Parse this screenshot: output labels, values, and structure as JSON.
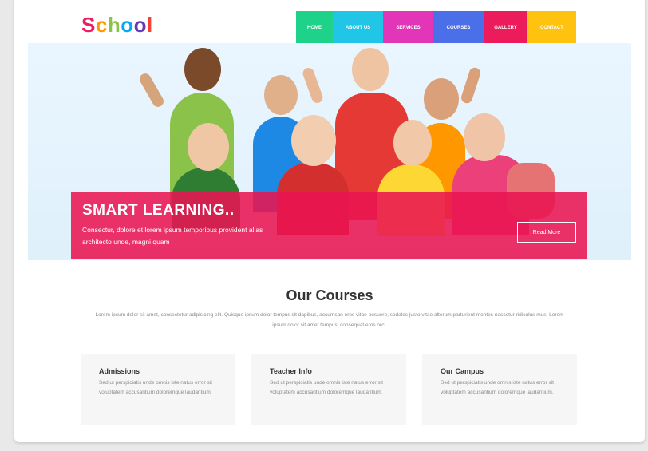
{
  "logo": {
    "letters": [
      "S",
      "c",
      "h",
      "o",
      "o",
      "l"
    ]
  },
  "nav": {
    "items": [
      {
        "label": "HOME",
        "color": "#1fd28a",
        "width": 46
      },
      {
        "label": "ABOUT US",
        "color": "#21c6e6",
        "width": 63
      },
      {
        "label": "SERVICES",
        "color": "#e335b8",
        "width": 63
      },
      {
        "label": "COURSES",
        "color": "#4b6fe8",
        "width": 63
      },
      {
        "label": "GALLERY",
        "color": "#ec1c5c",
        "width": 55
      },
      {
        "label": "CONTACT",
        "color": "#ffc20e",
        "width": 61
      }
    ]
  },
  "hero": {
    "title": "SMART LEARNING..",
    "text": "Consectur, dolore et lorem ipsum temporibus provident alias architecto unde, magni quam",
    "button_label": "Read More"
  },
  "courses": {
    "heading": "Our Courses",
    "description": "Lorem ipsum dolor sit amet, consectetur adipisicing elit. Quisque ipsum dolor tempus sit dapibus, accumsan eros vitae posuere, sodales justo vitae alterum parturient montes nascetur ridiculus mus. Lorem ipsum dolor sit amet tempus, consequat eros orci.",
    "items": [
      {
        "title": "Admissions",
        "text": "Sed ut perspiciatis unde omnis iste natus error sit voluptatem accusantium doloremque laudantium."
      },
      {
        "title": "Teacher Info",
        "text": "Sed ut perspiciatis unde omnis iste natus error sit voluptatem accusantium doloremque laudantium."
      },
      {
        "title": "Our Campus",
        "text": "Sed ut perspiciatis unde omnis iste natus error sit voluptatem accusantium doloremque laudantium."
      }
    ]
  },
  "colors": {
    "accent": "#e91552",
    "hero_bg": "#e4f3fd"
  }
}
